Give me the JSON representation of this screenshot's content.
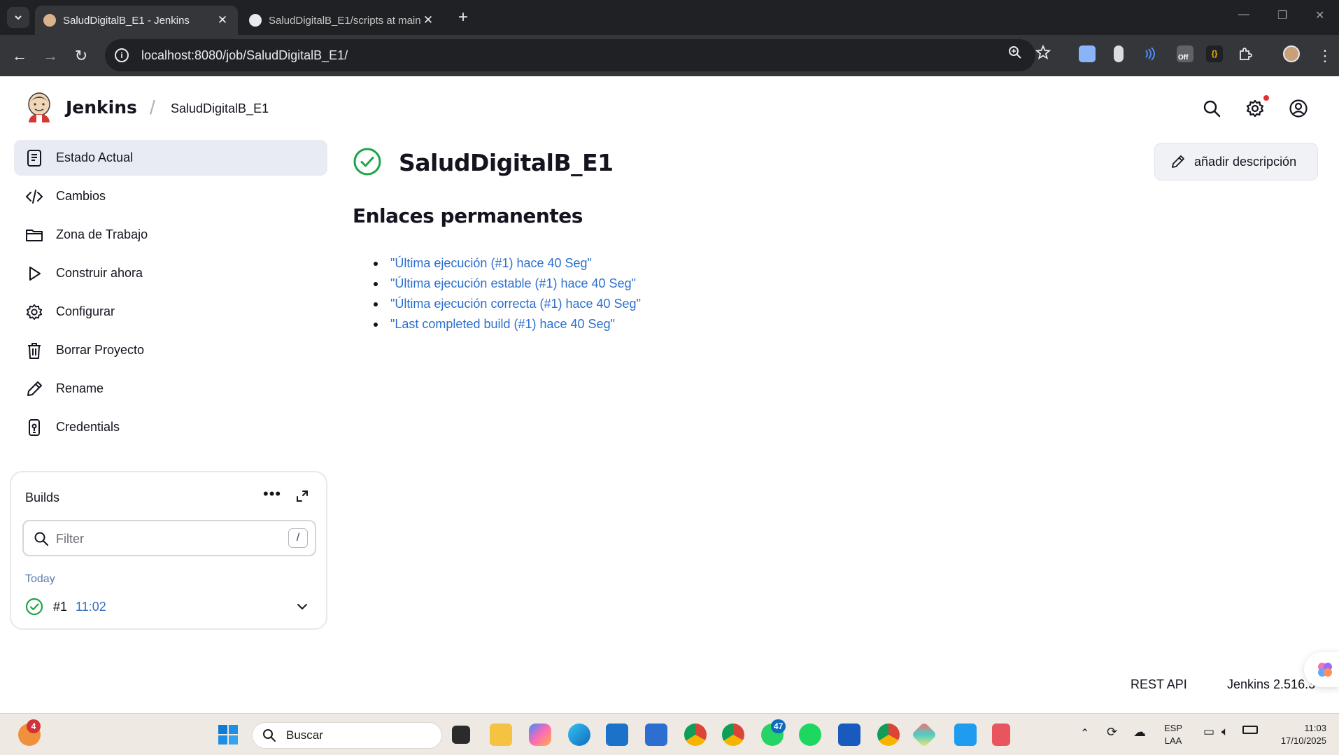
{
  "browser": {
    "tabs": [
      {
        "title": "SaludDigitalB_E1 - Jenkins",
        "active": true
      },
      {
        "title": "SaludDigitalB_E1/scripts at main",
        "active": false
      }
    ],
    "url": "localhost:8080/job/SaludDigitalB_E1/",
    "extension_off_label": "Off"
  },
  "header": {
    "brand": "Jenkins",
    "breadcrumb": "SaludDigitalB_E1"
  },
  "sidebar": {
    "items": [
      {
        "label": "Estado Actual",
        "icon": "status-icon"
      },
      {
        "label": "Cambios",
        "icon": "code-icon"
      },
      {
        "label": "Zona de Trabajo",
        "icon": "folder-icon"
      },
      {
        "label": "Construir ahora",
        "icon": "play-icon"
      },
      {
        "label": "Configurar",
        "icon": "gear-icon"
      },
      {
        "label": "Borrar Proyecto",
        "icon": "trash-icon"
      },
      {
        "label": "Rename",
        "icon": "pencil-icon"
      },
      {
        "label": "Credentials",
        "icon": "credentials-icon"
      }
    ]
  },
  "builds": {
    "title": "Builds",
    "filter_placeholder": "Filter",
    "filter_shortcut": "/",
    "group_label": "Today",
    "rows": [
      {
        "number": "#1",
        "time": "11:02",
        "status": "success"
      }
    ]
  },
  "main": {
    "job_title": "SaludDigitalB_E1",
    "add_description_label": "añadir descripción",
    "permalinks_title": "Enlaces permanentes",
    "permalinks": [
      "\"Última ejecución (#1) hace 40 Seg\"",
      "\"Última ejecución estable (#1) hace 40 Seg\"",
      "\"Última ejecución correcta (#1) hace 40 Seg\"",
      "\"Last completed build (#1) hace 40 Seg\""
    ]
  },
  "footer": {
    "rest_api": "REST API",
    "version": "Jenkins 2.516.3"
  },
  "taskbar": {
    "search_placeholder": "Buscar",
    "weather_badge": "4",
    "whatsapp_badge": "47",
    "language": "ESP",
    "layout": "LAA",
    "time": "11:03",
    "date": "17/10/2025"
  },
  "colors": {
    "success": "#1ea446",
    "link": "#2b6fcf",
    "active_bg": "#e9ebf2"
  }
}
